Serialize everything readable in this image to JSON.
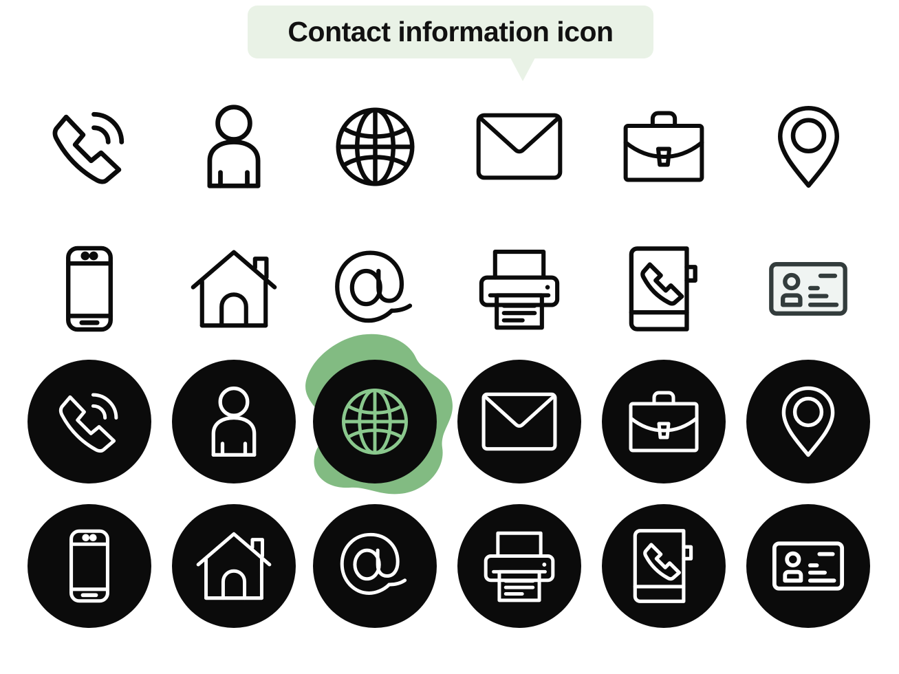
{
  "page": {
    "title": "Contact information icon",
    "background_color": "#ffffff",
    "bubble_color": "#e9f2e6",
    "title_color": "#111111",
    "highlight_blob_color": "#82bb82",
    "highlight_icon_color": "#8ac88d",
    "outline_color": "#0b0b0b",
    "disc_color": "#0b0b0b",
    "disc_icon_color": "#ffffff",
    "card_stroke_color": "#333c3c",
    "card_fill_color": "#f0f4f2"
  },
  "rows": [
    {
      "name": "row-outline-1",
      "style": "outline",
      "icons": [
        {
          "name": "phone-call-icon",
          "label": "Phone call"
        },
        {
          "name": "person-icon",
          "label": "Person"
        },
        {
          "name": "globe-icon",
          "label": "Globe"
        },
        {
          "name": "envelope-icon",
          "label": "Envelope"
        },
        {
          "name": "briefcase-icon",
          "label": "Briefcase"
        },
        {
          "name": "location-pin-icon",
          "label": "Location pin"
        }
      ]
    },
    {
      "name": "row-outline-2",
      "style": "outline",
      "icons": [
        {
          "name": "mobile-phone-icon",
          "label": "Mobile phone"
        },
        {
          "name": "house-icon",
          "label": "House"
        },
        {
          "name": "at-sign-icon",
          "label": "At sign"
        },
        {
          "name": "printer-icon",
          "label": "Printer"
        },
        {
          "name": "phone-book-icon",
          "label": "Phone book"
        },
        {
          "name": "id-card-icon",
          "label": "ID card"
        }
      ]
    },
    {
      "name": "row-filled-1",
      "style": "filled",
      "icons": [
        {
          "name": "phone-call-icon",
          "label": "Phone call"
        },
        {
          "name": "person-icon",
          "label": "Person"
        },
        {
          "name": "globe-icon",
          "label": "Globe",
          "highlighted": true
        },
        {
          "name": "envelope-icon",
          "label": "Envelope"
        },
        {
          "name": "briefcase-icon",
          "label": "Briefcase"
        },
        {
          "name": "location-pin-icon",
          "label": "Location pin"
        }
      ]
    },
    {
      "name": "row-filled-2",
      "style": "filled",
      "icons": [
        {
          "name": "mobile-phone-icon",
          "label": "Mobile phone"
        },
        {
          "name": "house-icon",
          "label": "House"
        },
        {
          "name": "at-sign-icon",
          "label": "At sign"
        },
        {
          "name": "printer-icon",
          "label": "Printer"
        },
        {
          "name": "phone-book-icon",
          "label": "Phone book"
        },
        {
          "name": "id-card-icon",
          "label": "ID card"
        }
      ]
    }
  ]
}
